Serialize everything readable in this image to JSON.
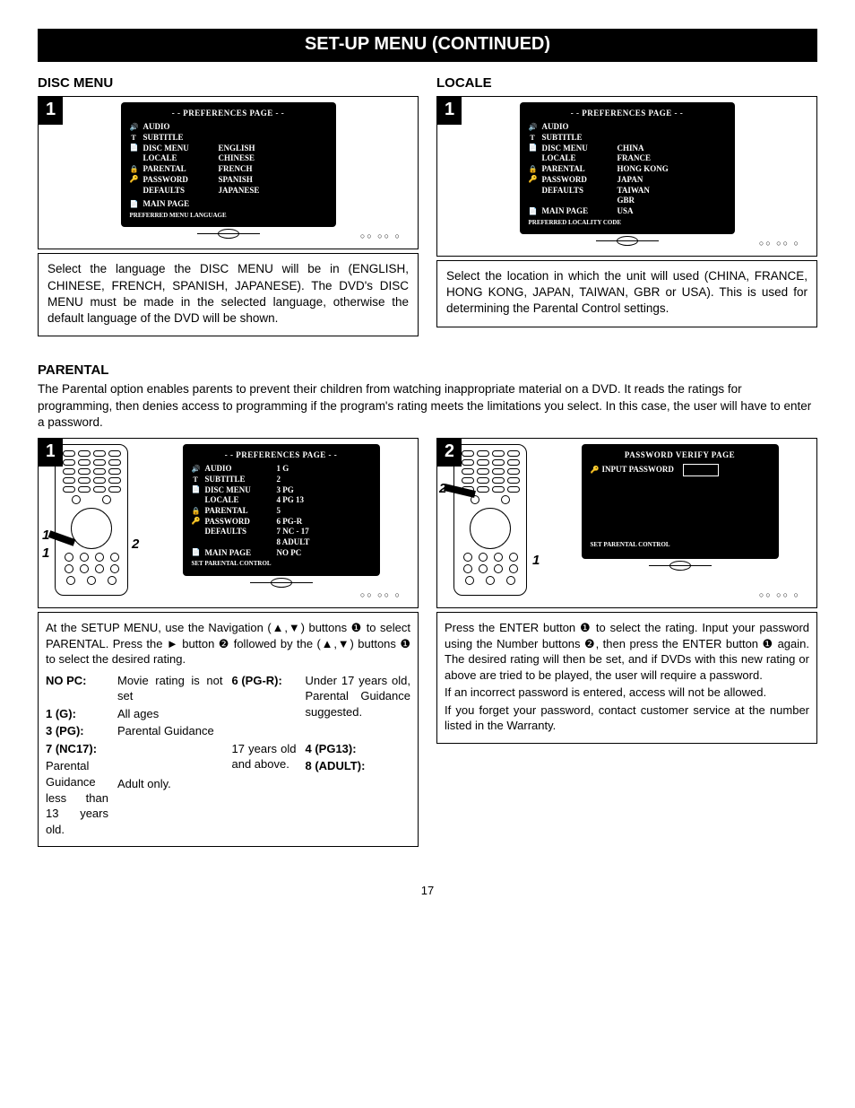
{
  "title": "SET-UP MENU (CONTINUED)",
  "pageNumber": "17",
  "discMenu": {
    "heading": "DISC MENU",
    "step": "1",
    "screen": {
      "title": "- - PREFERENCES PAGE - -",
      "rows": [
        {
          "icon": "🔊",
          "label": "AUDIO",
          "val": ""
        },
        {
          "icon": "T",
          "label": "SUBTITLE",
          "val": ""
        },
        {
          "icon": "📄",
          "label": "DISC MENU",
          "val": "ENGLISH"
        },
        {
          "icon": "",
          "label": "LOCALE",
          "val": "CHINESE"
        },
        {
          "icon": "🔒",
          "label": "PARENTAL",
          "val": "FRENCH"
        },
        {
          "icon": "🔑",
          "label": "PASSWORD",
          "val": "SPANISH"
        },
        {
          "icon": "",
          "label": "DEFAULTS",
          "val": "JAPANESE"
        }
      ],
      "mainPage": "MAIN PAGE",
      "footer": "PREFERRED MENU LANGUAGE"
    },
    "desc": "Select the language the DISC MENU will be in (ENGLISH, CHINESE, FRENCH, SPANISH, JAPANESE). The DVD's DISC MENU must be made in the selected language, otherwise the default language of the DVD will be shown."
  },
  "locale": {
    "heading": "LOCALE",
    "step": "1",
    "screen": {
      "title": "- - PREFERENCES PAGE - -",
      "rows": [
        {
          "icon": "🔊",
          "label": "AUDIO",
          "val": ""
        },
        {
          "icon": "T",
          "label": "SUBTITLE",
          "val": ""
        },
        {
          "icon": "📄",
          "label": "DISC MENU",
          "val": "CHINA"
        },
        {
          "icon": "",
          "label": "LOCALE",
          "val": "FRANCE"
        },
        {
          "icon": "🔒",
          "label": "PARENTAL",
          "val": "HONG KONG"
        },
        {
          "icon": "🔑",
          "label": "PASSWORD",
          "val": "JAPAN"
        },
        {
          "icon": "",
          "label": "DEFAULTS",
          "val": "TAIWAN"
        },
        {
          "icon": "",
          "label": "",
          "val": "GBR"
        }
      ],
      "mainPage": "MAIN PAGE",
      "mainPageVal": "USA",
      "footer": "PREFERRED LOCALITY CODE"
    },
    "desc": "Select the location in which the unit will used (CHINA, FRANCE, HONG KONG, JAPAN, TAIWAN, GBR or USA). This is used for determining the Parental Control settings."
  },
  "parental": {
    "heading": "PARENTAL",
    "intro": "The Parental option enables parents to prevent their children from watching inappropriate material on a DVD. It reads the ratings for programming, then denies access to programming if the program's rating meets the limitations you select. In this case, the user will have to enter a password.",
    "step1": {
      "num": "1",
      "screen": {
        "title": "- - PREFERENCES PAGE - -",
        "rows": [
          {
            "icon": "🔊",
            "label": "AUDIO",
            "val": "1 G"
          },
          {
            "icon": "T",
            "label": "SUBTITLE",
            "val": "2"
          },
          {
            "icon": "📄",
            "label": "DISC MENU",
            "val": "3 PG"
          },
          {
            "icon": "",
            "label": "LOCALE",
            "val": "4 PG 13"
          },
          {
            "icon": "🔒",
            "label": "PARENTAL",
            "val": "5"
          },
          {
            "icon": "🔑",
            "label": "PASSWORD",
            "val": "6 PG-R"
          },
          {
            "icon": "",
            "label": "DEFAULTS",
            "val": "7 NC - 17"
          },
          {
            "icon": "",
            "label": "",
            "val": "8 ADULT"
          }
        ],
        "mainPage": "MAIN PAGE",
        "mainPageVal": "NO PC",
        "footer": "SET PARENTAL CONTROL"
      },
      "desc": "At the SETUP MENU, use the Navigation (▲,▼) buttons ❶ to select PARENTAL. Press the ► button ❷ followed by the (▲,▼) buttons ❶ to select the desired rating.",
      "ratings": [
        {
          "k": "NO PC:",
          "v": "Movie rating is not set"
        },
        {
          "k": "1 (G):",
          "v": "All ages"
        },
        {
          "k": "3 (PG):",
          "v": "Parental Guidance"
        },
        {
          "k": "4 (PG13):",
          "v": "Parental Guidance less than 13 years old."
        },
        {
          "k": "6 (PG-R):",
          "v": "Under 17 years old, Parental Guidance suggested."
        },
        {
          "k": "7 (NC17):",
          "v": "17 years old and above."
        },
        {
          "k": "8 (ADULT):",
          "v": "Adult only."
        }
      ]
    },
    "step2": {
      "num": "2",
      "screen": {
        "title": "PASSWORD VERIFY PAGE",
        "inputLabel": "INPUT PASSWORD",
        "footer": "SET PARENTAL CONTROL"
      },
      "descA": "Press the ENTER button ❶ to select the rating. Input your password using the Number buttons ❷, then press the ENTER button ❶ again. The desired rating will then be set, and if DVDs with this new rating or above are tried to be played, the user will require a password.",
      "descB": "If an incorrect password is entered, access will not be allowed.",
      "descC": "If you forget your password, contact customer service at the number listed in the Warranty."
    }
  }
}
